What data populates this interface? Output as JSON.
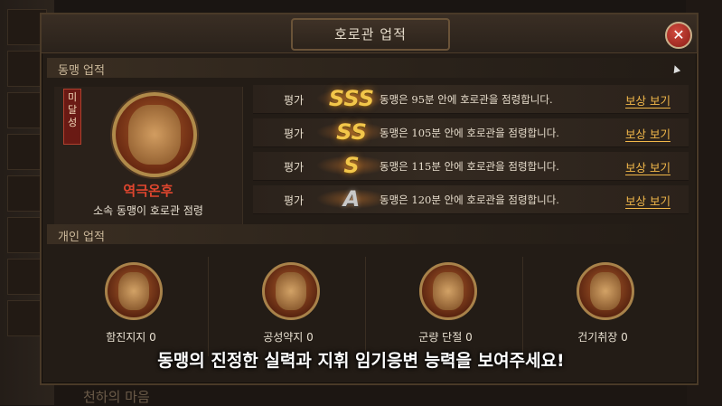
{
  "window": {
    "title": "호로관 업적"
  },
  "alliance_section": {
    "label": "동맹 업적",
    "badge": {
      "status": "미달성",
      "name": "역극온후",
      "description": "소속 동맹이 호로관 점령"
    },
    "rows": [
      {
        "eval_label": "평가",
        "grade": "SSS",
        "description": "동맹은 95분 안에 호로관을 점령합니다.",
        "reward": "보상 보기"
      },
      {
        "eval_label": "평가",
        "grade": "SS",
        "description": "동맹은 105분 안에 호로관을 점령합니다.",
        "reward": "보상 보기"
      },
      {
        "eval_label": "평가",
        "grade": "S",
        "description": "동맹은 115분 안에 호로관을 점령합니다.",
        "reward": "보상 보기"
      },
      {
        "eval_label": "평가",
        "grade": "A",
        "description": "동맹은 120분 안에 호로관을 점령합니다.",
        "reward": "보상 보기"
      }
    ]
  },
  "personal_section": {
    "label": "개인 업적",
    "items": [
      {
        "label": "함진지지 0"
      },
      {
        "label": "공성약지 0"
      },
      {
        "label": "군량 단절 0"
      },
      {
        "label": "건기취장 0"
      }
    ]
  },
  "background": {
    "bottom_text": "천하의 마음"
  },
  "subtitle": "동맹의 진정한 실력과 지휘 임기응변 능력을 보여주세요!",
  "colors": {
    "accent_gold": "#f2c64a",
    "badge_red": "#e0462e",
    "reward_link": "#f2b84a"
  }
}
